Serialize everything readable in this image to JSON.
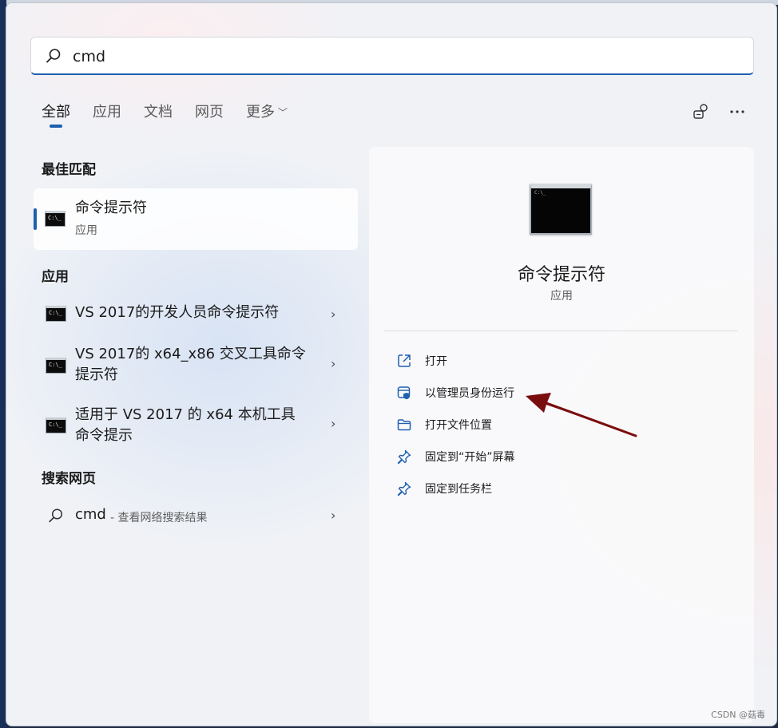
{
  "search": {
    "value": "cmd",
    "placeholder": ""
  },
  "tabs": [
    {
      "label": "全部",
      "active": true
    },
    {
      "label": "应用",
      "active": false
    },
    {
      "label": "文档",
      "active": false
    },
    {
      "label": "网页",
      "active": false
    },
    {
      "label": "更多",
      "active": false
    }
  ],
  "top_icons": {
    "feedback": "feedback-icon",
    "more": "more-options-icon"
  },
  "sections": {
    "best_match": "最佳匹配",
    "apps": "应用",
    "web": "搜索网页"
  },
  "best_match_item": {
    "title": "命令提示符",
    "subtitle": "应用"
  },
  "app_items": [
    {
      "title_line1": "VS 2017的开发人员命令提示符",
      "title_line2": ""
    },
    {
      "title_line1": "VS 2017的 x64_x86 交叉工具命令",
      "title_line2": "提示符"
    },
    {
      "title_line1": "适用于 VS 2017 的 x64 本机工具",
      "title_line2": "命令提示"
    }
  ],
  "web_item": {
    "query": "cmd",
    "suffix": " - 查看网络搜索结果"
  },
  "detail": {
    "title": "命令提示符",
    "subtitle": "应用",
    "actions": [
      {
        "label": "打开",
        "icon": "open-external-icon"
      },
      {
        "label": "以管理员身份运行",
        "icon": "shield-admin-icon"
      },
      {
        "label": "打开文件位置",
        "icon": "folder-icon"
      },
      {
        "label": "固定到“开始”屏幕",
        "icon": "pin-icon"
      },
      {
        "label": "固定到任务栏",
        "icon": "pin-icon"
      }
    ]
  },
  "watermark": "CSDN @菇毒",
  "colors": {
    "accent": "#1f5fae",
    "arrow": "#7a0d0d"
  }
}
